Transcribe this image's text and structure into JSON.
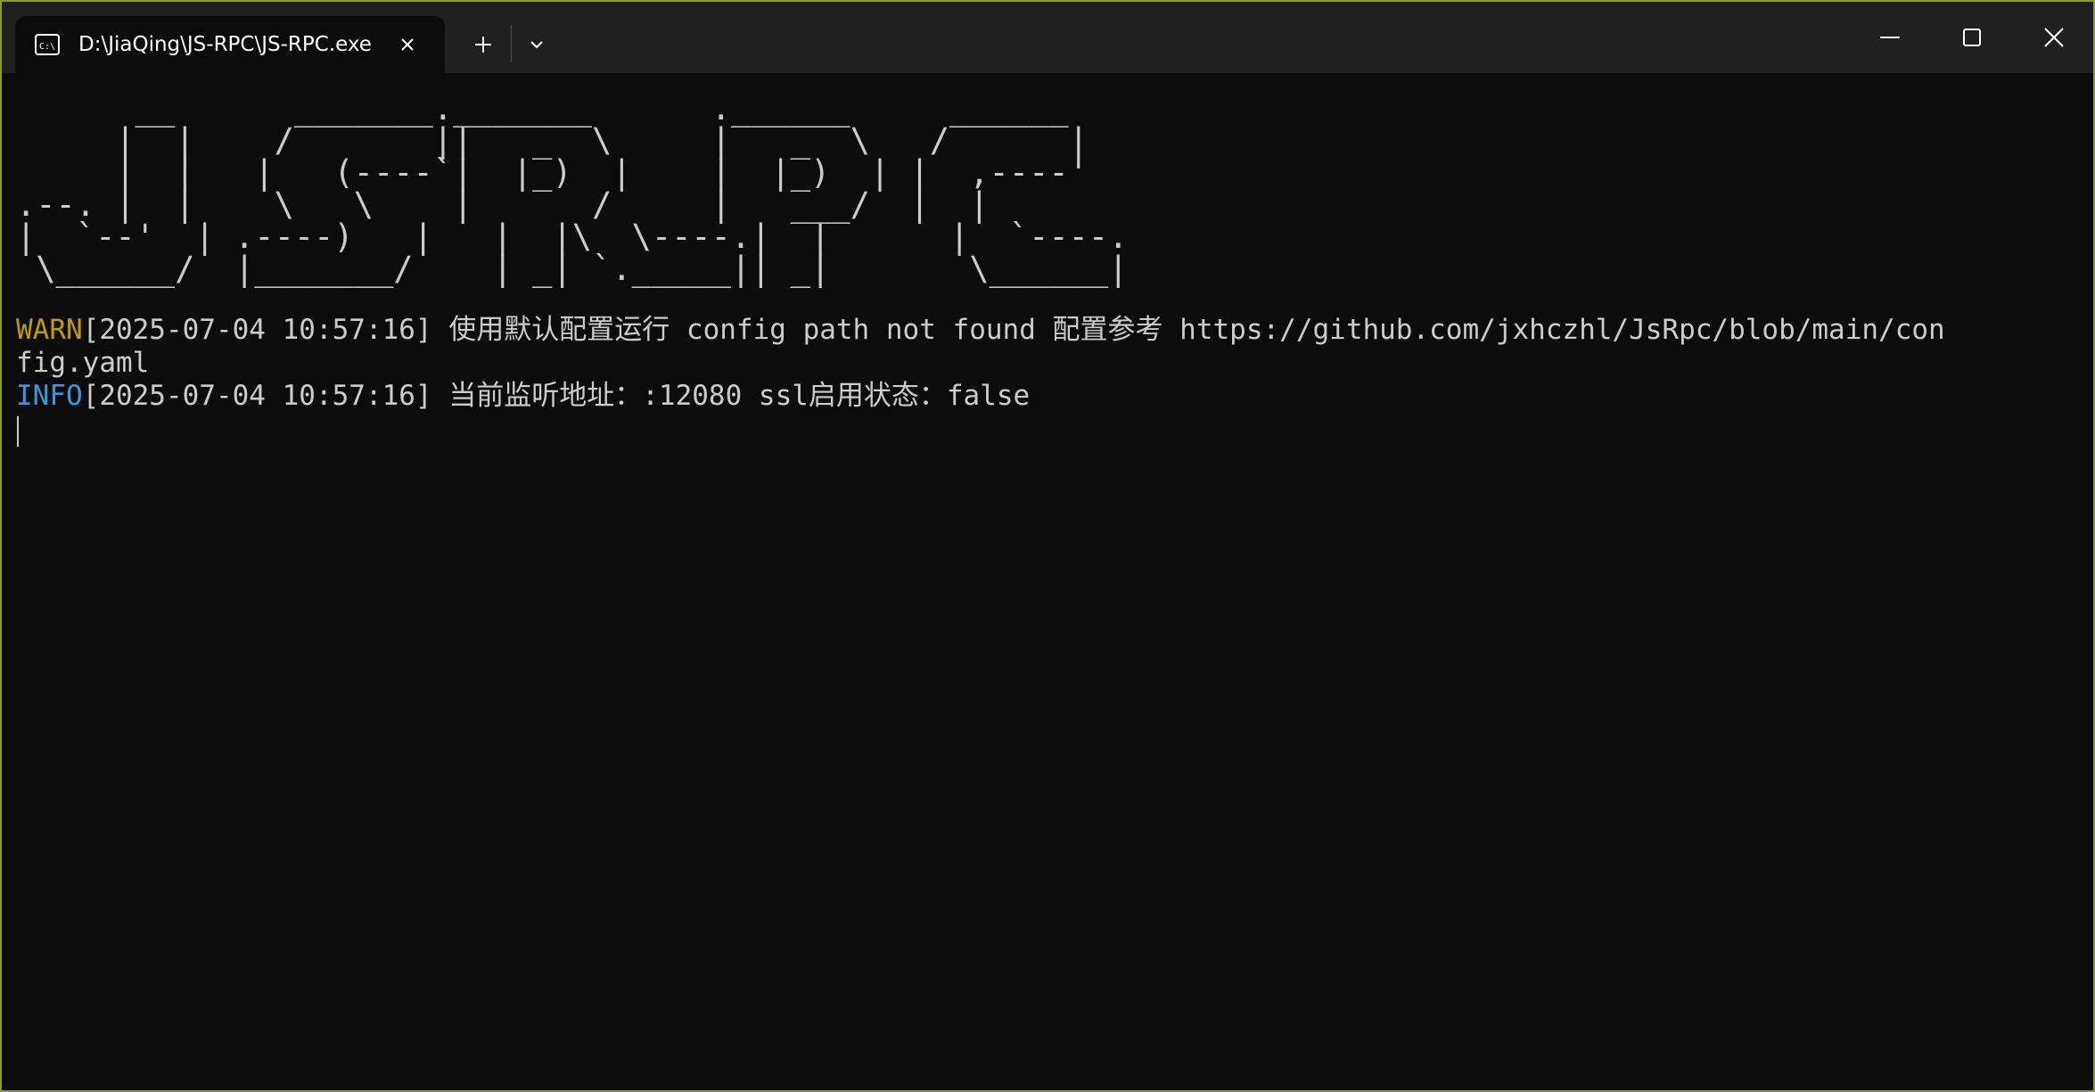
{
  "tab": {
    "title": "D:\\JiaQing\\JS-RPC\\JS-RPC.exe",
    "icon": "terminal-icon"
  },
  "titlebar": {
    "new_tab_icon": "plus-icon",
    "dropdown_icon": "chevron-down-icon",
    "minimize_icon": "minimize-icon",
    "maximize_icon": "maximize-icon",
    "close_icon": "close-icon"
  },
  "terminal": {
    "banner": "      __      _______._______      .______     ______\n     |  |    /       ||   _  \\     |   _  \\   /      |\n     |  |   |   (----`|  |_)  |    |  |_)  | |  ,----'\n.--. |  |    \\   \\    |      /     |   ___/  |  |\n|  `--'  | .----)   |   |  |\\  \\----.|  |      |  `----.\n \\______/  |_______/    | _| `._____|| _|       \\______|",
    "lines": [
      {
        "level": "WARN",
        "text": "[2025-07-04 10:57:16] 使用默认配置运行 config path not found 配置参考 https://github.com/jxhczhl/JsRpc/blob/main/con"
      },
      {
        "level": "",
        "text": "fig.yaml"
      },
      {
        "level": "INFO",
        "text": "[2025-07-04 10:57:16] 当前监听地址：:12080 ssl启用状态：false"
      }
    ]
  },
  "colors": {
    "background": "#0c0c0c",
    "foreground": "#cccccc",
    "warn": "#c19c00",
    "info": "#3a96dd",
    "titlebar": "#202020"
  }
}
